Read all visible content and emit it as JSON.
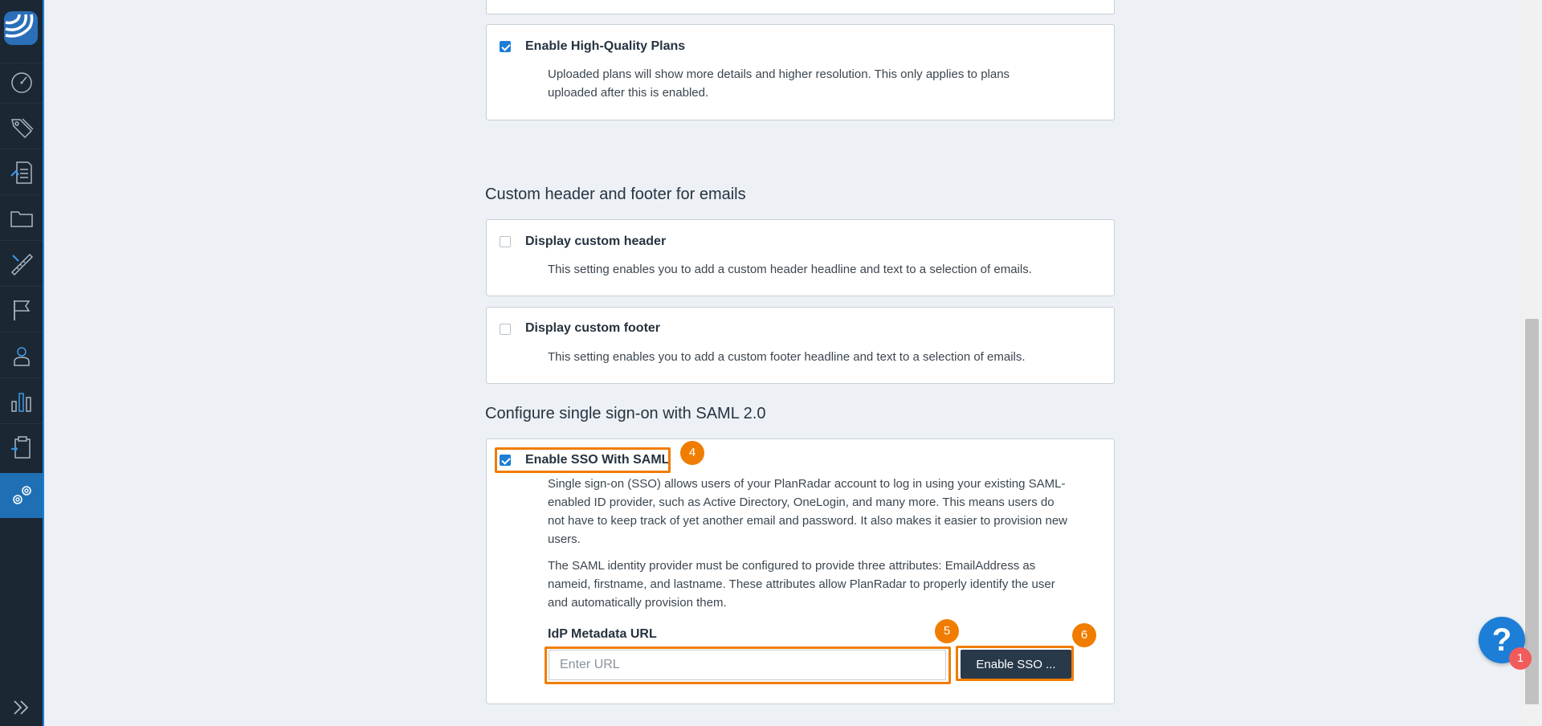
{
  "sidebar": {
    "items": [
      {
        "icon": "dashboard-gauge-icon"
      },
      {
        "icon": "tags-icon"
      },
      {
        "icon": "tickets-report-icon"
      },
      {
        "icon": "folder-icon"
      },
      {
        "icon": "ruler-pencil-icon"
      },
      {
        "icon": "flag-icon"
      },
      {
        "icon": "user-icon"
      },
      {
        "icon": "bar-chart-icon"
      },
      {
        "icon": "clipboard-icon"
      },
      {
        "icon": "settings-gears-icon"
      }
    ],
    "expand_icon": "double-chevron-right-icon"
  },
  "hq_plans": {
    "title": "Enable High-Quality Plans",
    "checked": true,
    "description": "Uploaded plans will show more details and higher resolution. This only applies to plans uploaded after this is enabled."
  },
  "emails_section": {
    "title": "Custom header and footer for emails",
    "header": {
      "title": "Display custom header",
      "checked": false,
      "description": "This setting enables you to add a custom header headline and text to a selection of emails."
    },
    "footer": {
      "title": "Display custom footer",
      "checked": false,
      "description": "This setting enables you to add a custom footer headline and text to a selection of emails."
    }
  },
  "saml_section": {
    "title": "Configure single sign-on with SAML 2.0",
    "enable_label": "Enable SSO With SAML",
    "checked": true,
    "paragraph1": "Single sign-on (SSO) allows users of your PlanRadar account to log in using your existing SAML-enabled ID provider, such as Active Directory, OneLogin, and many more. This means users do not have to keep track of yet another email and password. It also makes it easier to provision new users.",
    "paragraph2": "The SAML identity provider must be configured to provide three attributes: EmailAddress as nameid, firstname, and lastname. These attributes allow PlanRadar to properly identify the user and automatically provision them.",
    "idp_label": "IdP Metadata URL",
    "idp_value": "",
    "idp_placeholder": "Enter URL",
    "enable_button": "Enable SSO ..."
  },
  "annotations": {
    "badge4": "4",
    "badge5": "5",
    "badge6": "6"
  },
  "help": {
    "label": "?",
    "count": "1"
  },
  "colors": {
    "accent": "#1c7ed6",
    "highlight": "#f07d00",
    "sidebar": "#1b2733",
    "button": "#28394a"
  }
}
